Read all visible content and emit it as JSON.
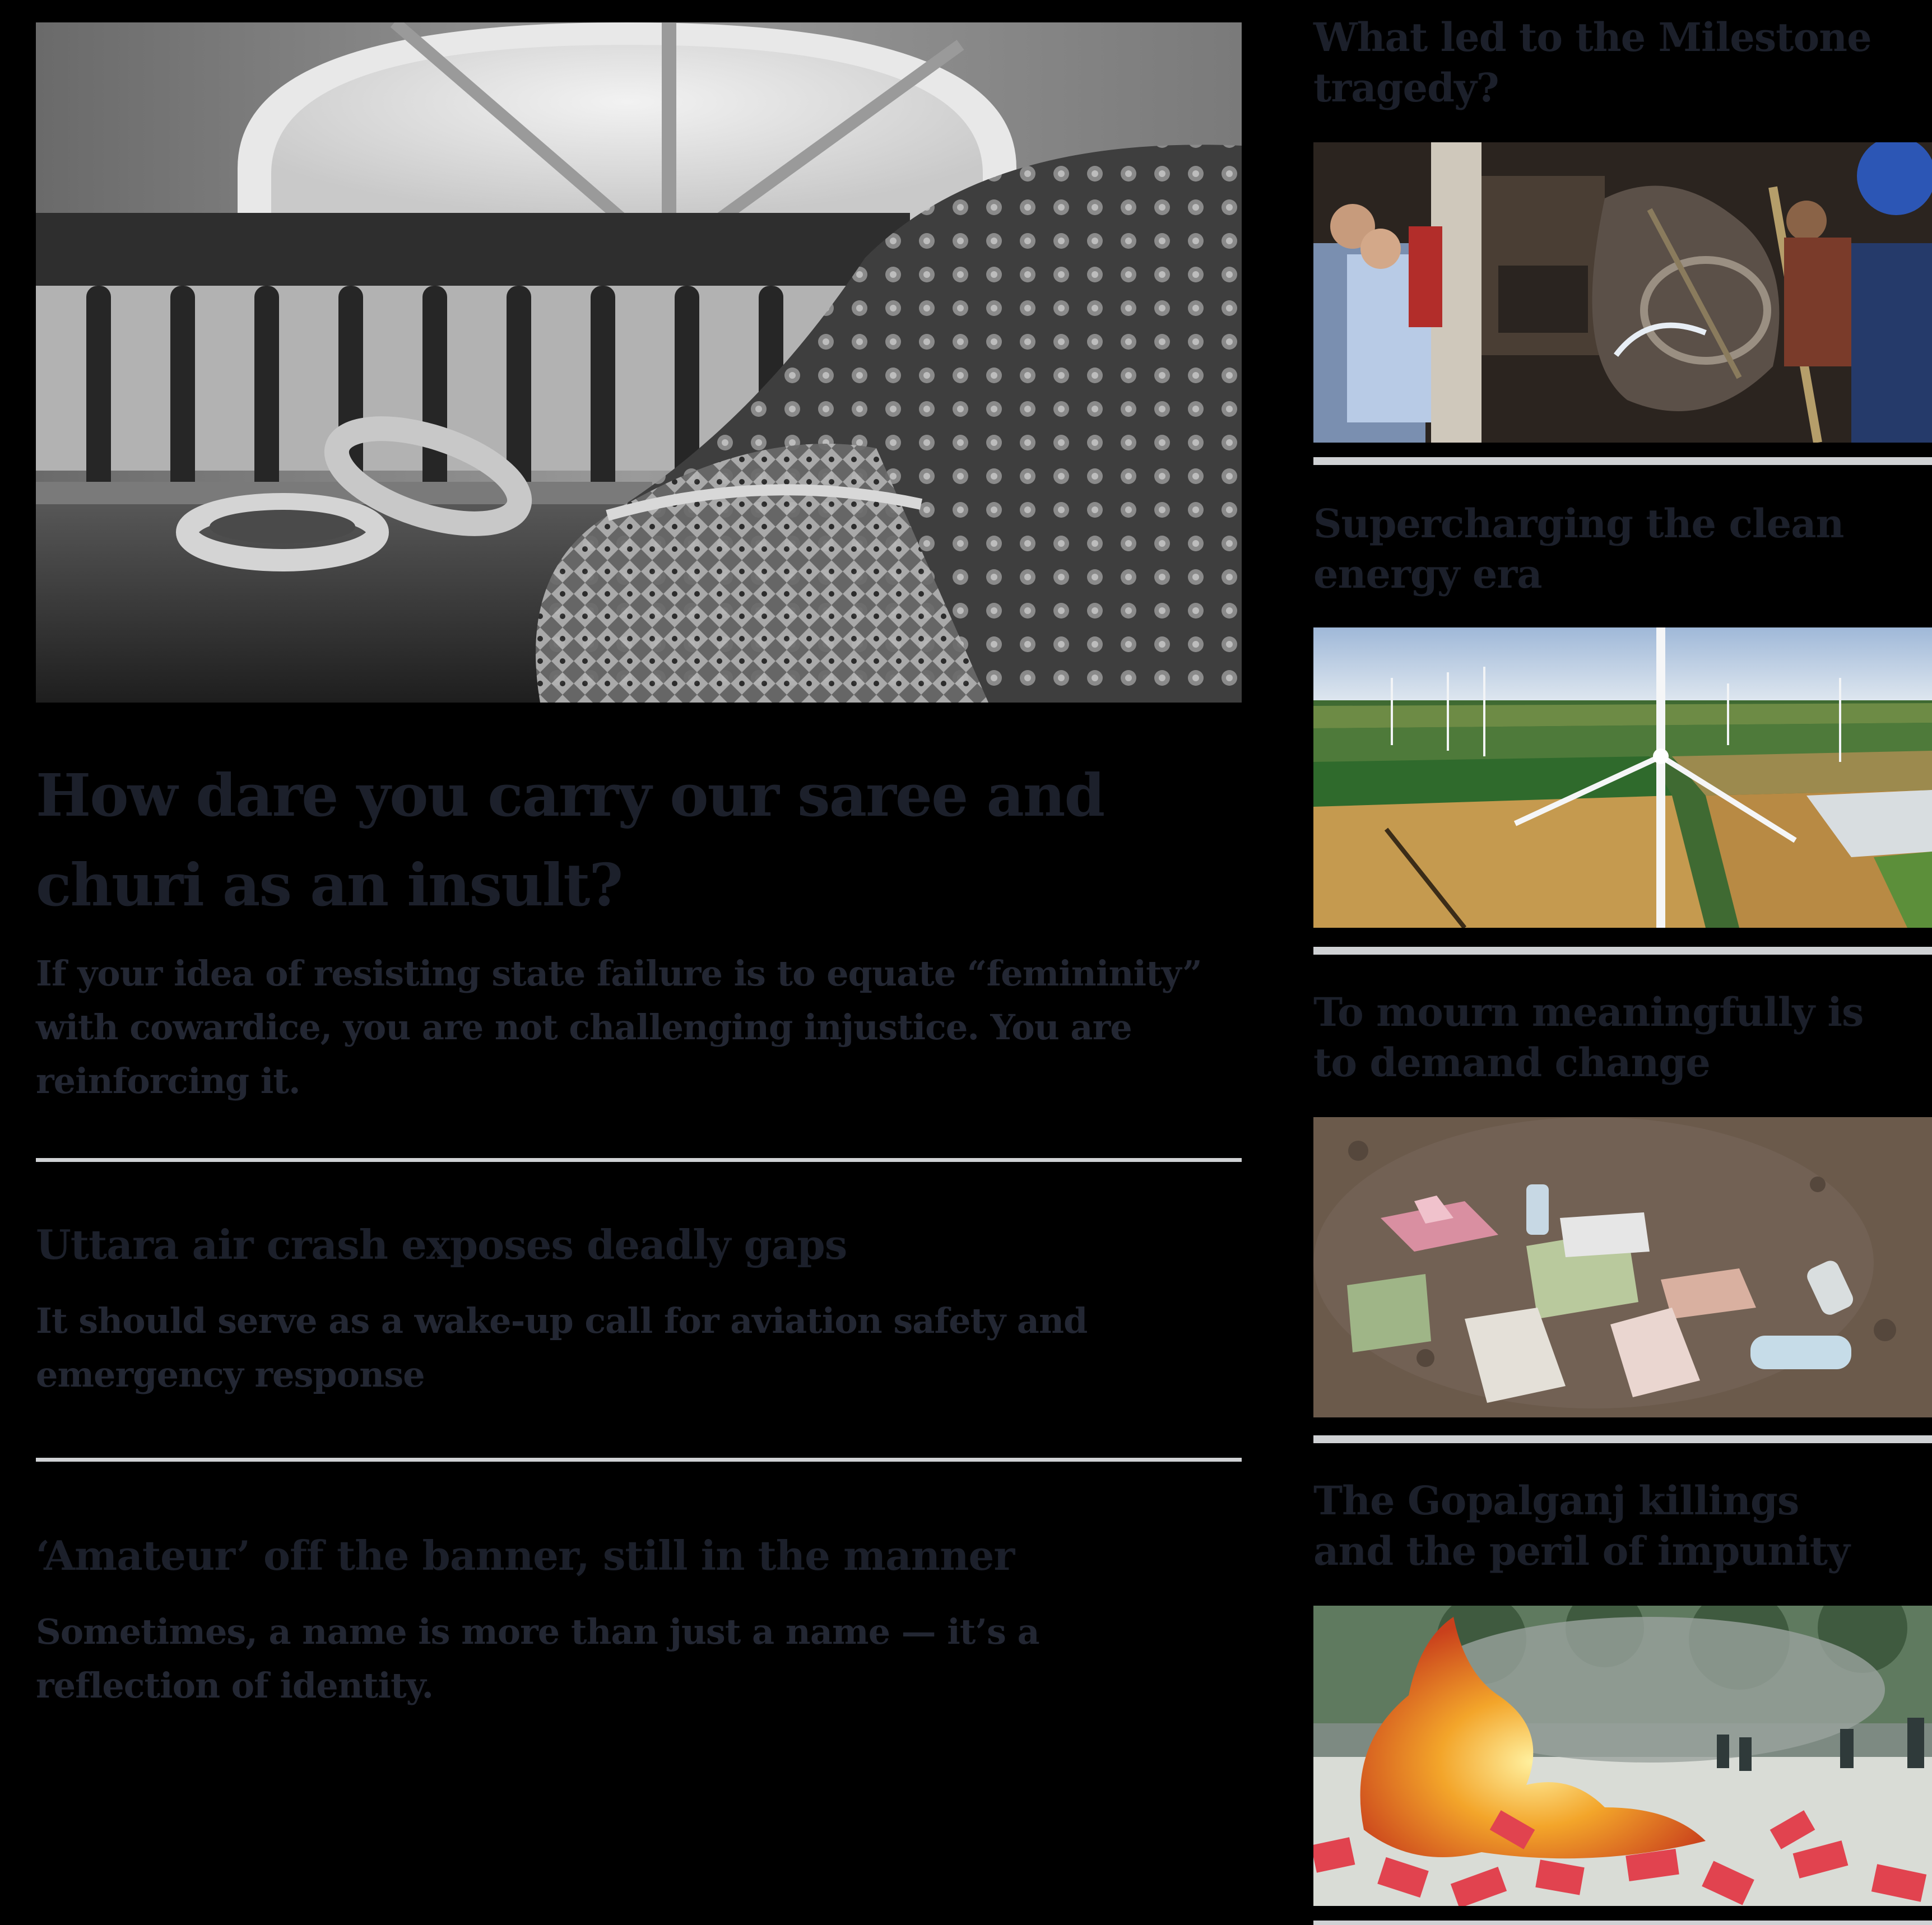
{
  "lead_story": {
    "title": "How dare you carry our saree and churi as an insult?",
    "summary": "If your idea of resisting state failure is to equate “femininity” with cowardice, you are not challenging injustice. You are reinforcing it.",
    "image_icon": "saree-bangles-photo"
  },
  "stories": [
    {
      "title": "Uttara air crash exposes deadly gaps",
      "summary": "It should serve as a wake-up call for aviation safety and emergency response"
    },
    {
      "title": "‘Amateur’ off the banner, still in the manner",
      "summary": "Sometimes, a name is more than just a name — it’s a reflection of identity."
    }
  ],
  "sidebar": [
    {
      "title": "What led to the Milestone tragedy?",
      "image_icon": "crash-site-photo"
    },
    {
      "title": "Supercharging the clean energy era",
      "image_icon": "wind-turbine-photo"
    },
    {
      "title": "To mourn meaningfully is to demand change",
      "image_icon": "debris-ground-photo"
    },
    {
      "title": "The Gopalganj killings and the peril of impunity",
      "image_icon": "street-fire-photo"
    }
  ],
  "colors": {
    "background": "#000000",
    "text": "#1c202b",
    "divider": "#cfd1d4"
  }
}
